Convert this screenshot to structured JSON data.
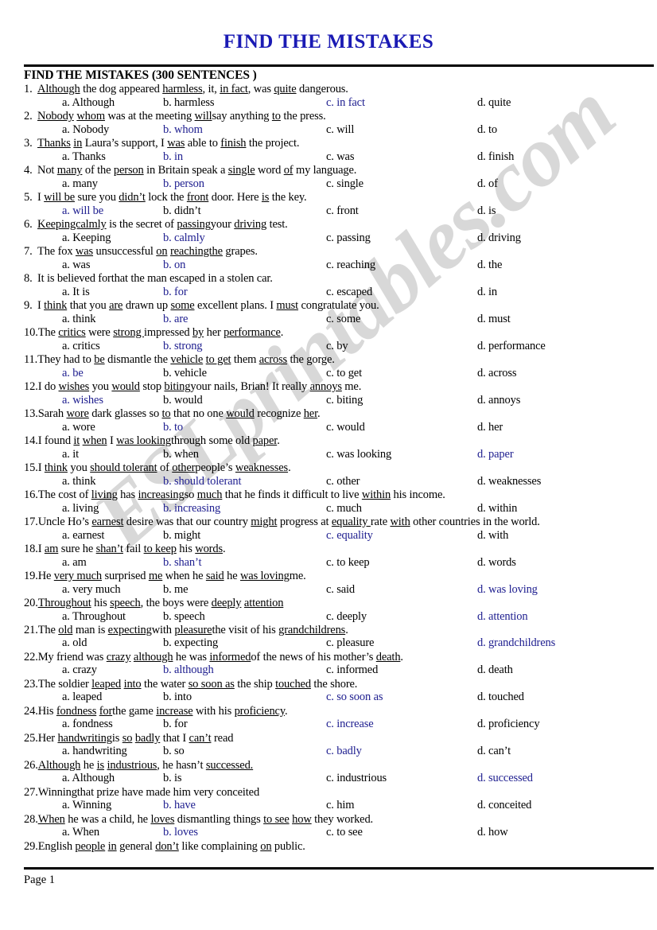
{
  "document": {
    "title": "FIND THE MISTAKES",
    "title_color": "#1a1ab4",
    "section_heading": "FIND THE MISTAKES (300 SENTENCES )",
    "footer": "Page 1",
    "watermark": "ESLprintables.com"
  },
  "questions": [
    {
      "num": "1.",
      "sentence_html": "<span class=\"u\">Although</span> the dog appeared <span class=\"u\">harmless</span>, it, <span class=\"u\">in fact</span>, was <span class=\"u\">quite</span> dangerous.",
      "a": "a. Although",
      "b": "b. harmless",
      "c": "c. in fact",
      "d": "d. quite",
      "answer": "c"
    },
    {
      "num": "2.",
      "sentence_html": "<span class=\"u\">Nobody</span> <span class=\"u\">whom</span> was at the meeting <span class=\"u\">will</span>say anything <span class=\"u\">to</span> the press.",
      "a": "a. Nobody",
      "b": "b. whom",
      "c": "c. will",
      "d": "d. to",
      "answer": "b"
    },
    {
      "num": "3.",
      "sentence_html": "<span class=\"u\">Thanks</span> <span class=\"u\">in</span> Laura’s support, I <span class=\"u\">was</span> able to <span class=\"u\">finish</span> the project.",
      "a": "a. Thanks",
      "b": "b. in",
      "c": "c. was",
      "d": "d. finish",
      "answer": "b"
    },
    {
      "num": "4.",
      "sentence_html": "Not <span class=\"u\">many</span> of the <span class=\"u\">person</span> in Britain speak a <span class=\"u\">single</span> word <span class=\"u\">of</span> my language.",
      "a": "a. many",
      "b": "b. person",
      "c": "c. single",
      "d": "d. of",
      "answer": "b"
    },
    {
      "num": "5.",
      "sentence_html": "I <span class=\"u\">will be</span> sure you <span class=\"u\">didn’t</span> lock the <span class=\"u\">front</span> door. Here <span class=\"u\">is</span> the key.",
      "a": "a. will be",
      "b": "b. didn’t",
      "c": "c. front",
      "d": "d. is",
      "answer": "a"
    },
    {
      "num": "6.",
      "sentence_html": "<span class=\"u\">Keepingcalmly</span> is the secret of <span class=\"u\">passing</span>your <span class=\"u\">driving</span> test.",
      "a": "a. Keeping",
      "b": "b. calmly",
      "c": "c. passing",
      "d": "d. driving",
      "answer": "b"
    },
    {
      "num": "7.",
      "sentence_html": "The fox <span class=\"u\">was</span> unsuccessful <span class=\"u\">on</span> <span class=\"u\">reachingthe</span> grapes.",
      "a": "a. was",
      "b": "b. on",
      "c": "c. reaching",
      "d": "d. the",
      "answer": "b"
    },
    {
      "num": "8.",
      "sentence_html": "It is believed forthat the man escaped in a stolen car.",
      "a": "a. It is",
      "b": "b. for",
      "c": "c. escaped",
      "d": "d. in",
      "answer": "b"
    },
    {
      "num": "9.",
      "sentence_html": "I <span class=\"u\">think</span> that you <span class=\"u\">are</span> drawn up <span class=\"u\">some</span> excellent plans. I <span class=\"u\">must</span> congratulate you.",
      "a": "a. think",
      "b": "b. are",
      "c": "c. some",
      "d": "d. must",
      "answer": "b"
    },
    {
      "num": "10.",
      "sentence_html": "The <span class=\"u\">critics</span> were <span class=\"u\">strong </span>impressed <span class=\"u\">by</span> her <span class=\"u\">performance</span>.",
      "a": "a. critics",
      "b": "b. strong",
      "c": "c. by",
      "d": "d. performance",
      "answer": "b"
    },
    {
      "num": "11.",
      "sentence_html": "They had to <span class=\"u\">be</span> dismantle the <span class=\"u\">vehicle</span> <span class=\"u\">to get</span> them <span class=\"u\">across</span> the gorge.",
      "a": "a. be",
      "b": "b. vehicle",
      "c": "c. to get",
      "d": "d. across",
      "answer": "a"
    },
    {
      "num": "12.",
      "sentence_html": "I do <span class=\"u\">wishes</span> you <span class=\"u\">would</span> stop <span class=\"u\">biting</span>your nails, Brian! It really <span class=\"u\">annoys</span> me.",
      "a": "a. wishes",
      "b": "b. would",
      "c": "c. biting",
      "d": "d. annoys",
      "answer": "a"
    },
    {
      "num": "13.",
      "sentence_html": "Sarah <span class=\"u\">wore</span> dark glasses so <span class=\"u\">to</span> that no one <span class=\"u\">would</span> recognize <span class=\"u\">her</span>.",
      "a": "a. wore",
      "b": "b. to",
      "c": "c. would",
      "d": "d. her",
      "answer": "b"
    },
    {
      "num": "14.",
      "sentence_html": "I found <span class=\"u\">it</span> <span class=\"u\">when</span> I <span class=\"u\">was looking</span>through some old <span class=\"u\">paper</span>.",
      "a": "a. it",
      "b": "b. when",
      "c": "c. was looking",
      "d": "d. paper",
      "answer": "d"
    },
    {
      "num": "15.",
      "sentence_html": "I <span class=\"u\">think</span> you <span class=\"u\">should tolerant</span> of <span class=\"u\">other</span>people’s <span class=\"u\">weaknesses</span>.",
      "a": "a. think",
      "b": "b. should tolerant",
      "c": "c. other",
      "d": "d. weaknesses",
      "answer": "b"
    },
    {
      "num": "16.",
      "sentence_html": "The cost of <span class=\"u\">living</span> has <span class=\"u\">increasing</span>so <span class=\"u\">much</span> that he finds it difficult to live <span class=\"u\">within</span> his income.",
      "a": "a. living",
      "b": "b. increasing",
      "c": "c. much",
      "d": "d. within",
      "answer": "b"
    },
    {
      "num": "17.",
      "sentence_html": "Uncle Ho’s <span class=\"u\">earnest</span> desire was that our country <span class=\"u\">might</span> progress at <span class=\"u\">equality </span>rate <span class=\"u\">with</span> other countries in the world.",
      "a": "a. earnest",
      "b": "b. might",
      "c": "c. equality",
      "d": "d. with",
      "answer": "c"
    },
    {
      "num": "18.",
      "sentence_html": "I <span class=\"u\">am</span> sure he <span class=\"u\">shan’t</span> fail <span class=\"u\">to keep</span> his <span class=\"u\">words</span>.",
      "a": "a. am",
      "b": "b. shan’t",
      "c": "c. to keep",
      "d": "d. words",
      "answer": "b"
    },
    {
      "num": "19.",
      "sentence_html": "He <span class=\"u\">very much</span> surprised <span class=\"u\">me</span> when he <span class=\"u\">said</span> he <span class=\"u\">was loving</span>me.",
      "a": "a. very much",
      "b": "b. me",
      "c": "c. said",
      "d": "d. was loving",
      "answer": "d"
    },
    {
      "num": "20.",
      "sentence_html": "<span class=\"u\">Throughout</span> his <span class=\"u\">speech</span>, the boys were <span class=\"u\">deeply</span> <span class=\"u\">attention</span>",
      "a": "a. Throughout",
      "b": "b. speech",
      "c": "c. deeply",
      "d": "d. attention",
      "answer": "d"
    },
    {
      "num": "21.",
      "sentence_html": "The <span class=\"u\">old</span> man is <span class=\"u\">expecting</span>with <span class=\"u\">pleasure</span>the visit of his <span class=\"u\">grandchildrens</span>.",
      "a": "a. old",
      "b": "b. expecting",
      "c": "c. pleasure",
      "d": "d. grandchildrens",
      "answer": "d"
    },
    {
      "num": "22.",
      "sentence_html": "My friend was <span class=\"u\">crazy</span> <span class=\"u\">although</span> he was <span class=\"u\">informed</span>of the news of his mother’s <span class=\"u\">death</span>.",
      "a": "a. crazy",
      "b": "b. although",
      "c": "c. informed",
      "d": "d. death",
      "answer": "b"
    },
    {
      "num": "23.",
      "sentence_html": "The soldier <span class=\"u\">leaped</span> <span class=\"u\">into</span> the water <span class=\"u\">so soon as</span> the ship <span class=\"u\">touched</span> the shore.",
      "a": "a. leaped",
      "b": "b. into",
      "c": "c. so soon as",
      "d": "d. touched",
      "answer": "c"
    },
    {
      "num": "24.",
      "sentence_html": "His <span class=\"u\">fondness</span> <span class=\"u\">for</span>the game <span class=\"u\">increase</span> with his <span class=\"u\">proficiency</span>.",
      "a": "a. fondness",
      "b": "b. for",
      "c": "c. increase",
      "d": "d. proficiency",
      "answer": "c"
    },
    {
      "num": "25.",
      "sentence_html": "Her <span class=\"u\">handwriting</span>is <span class=\"u\">so</span> <span class=\"u\">badly</span> that I <span class=\"u\">can’t</span> read",
      "a": "a. handwriting",
      "b": "b. so",
      "c": "c. badly",
      "d": "d. can’t",
      "answer": "c"
    },
    {
      "num": "26.",
      "sentence_html": "<span class=\"u\">Although</span> he <span class=\"u\">is</span> <span class=\"u\">industrious</span>, he hasn’t <span class=\"u\">successed.</span>",
      "a": "a. Although",
      "b": "b. is",
      "c": "c. industrious",
      "d": "d. successed",
      "answer": "d"
    },
    {
      "num": "27.",
      "sentence_html": "Winningthat prize have made him very conceited",
      "a": "a. Winning",
      "b": "b. have",
      "c": "c. him",
      "d": "d. conceited",
      "answer": "b"
    },
    {
      "num": "28.",
      "sentence_html": "<span class=\"u\">When</span> he was a child, he <span class=\"u\">loves</span> dismantling things <span class=\"u\">to see</span> <span class=\"u\">how</span> they worked.",
      "a": "a. When",
      "b": "b. loves",
      "c": "c. to see",
      "d": "d. how",
      "answer": "b"
    },
    {
      "num": "29.",
      "sentence_html": "English <span class=\"u\">people</span> <span class=\"u\">in</span> general <span class=\"u\">don’t</span> like complaining <span class=\"u\">on</span> public.",
      "a": "",
      "b": "",
      "c": "",
      "d": "",
      "answer": ""
    }
  ]
}
